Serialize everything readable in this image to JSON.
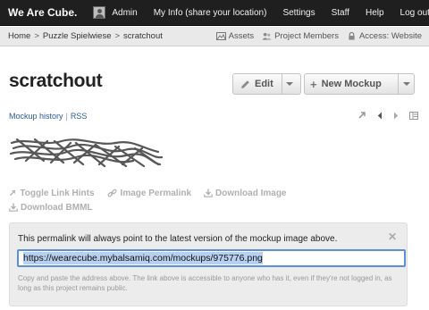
{
  "nav": {
    "brand": "We Are Cube.",
    "user": "Admin",
    "items": [
      "My Info (share your location)",
      "Settings",
      "Staff",
      "Help",
      "Log out"
    ]
  },
  "breadcrumb": {
    "items": [
      "Home",
      "Puzzle Spielwiese",
      "scratchout"
    ],
    "separator": ">",
    "right_links": [
      {
        "icon": "assets-icon",
        "label": "Assets"
      },
      {
        "icon": "members-icon",
        "label": "Project Members"
      },
      {
        "icon": "lock-icon",
        "label": "Access: Website"
      }
    ]
  },
  "page": {
    "title": "scratchout",
    "edit_label": "Edit",
    "new_mockup_label": "New Mockup"
  },
  "sublinks": {
    "history": "Mockup history",
    "separator": "|",
    "rss": "RSS"
  },
  "actions": {
    "toggle_hints": "Toggle Link Hints",
    "image_permalink": "Image Permalink",
    "download_image": "Download Image",
    "download_bmml": "Download BMML"
  },
  "permalink_panel": {
    "message": "This permalink will always point to the latest version of the mockup image above.",
    "url": "https://wearecube.mybalsamiq.com/mockups/975776.png",
    "note": "Copy and paste the address above. The link above is accessible to anyone who has it, even if they're not logged in, as long as this project remains public.",
    "close": "✕"
  },
  "colors": {
    "topbar": "#1f1f1f",
    "link": "#2a5aa0",
    "input_focus": "#5b8fd6"
  }
}
